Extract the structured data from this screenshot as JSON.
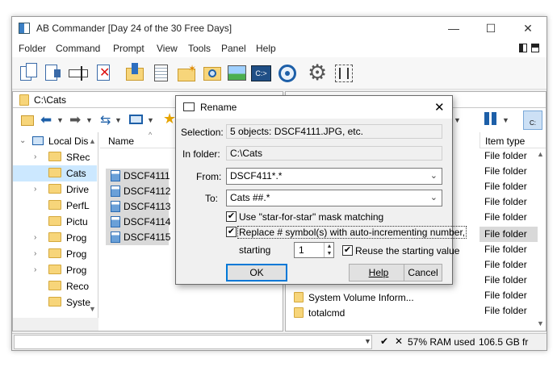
{
  "window": {
    "title": "AB Commander [Day 24 of the 30 Free Days]",
    "minimize": "—",
    "maximize": "☐",
    "close": "✕"
  },
  "menubar": {
    "items": [
      "Folder",
      "Command",
      "Prompt",
      "View",
      "Tools",
      "Panel",
      "Help"
    ]
  },
  "left_pane": {
    "path": "C:\\Cats",
    "tree_root": "Local Dis",
    "tree": [
      {
        "label": "SRec",
        "chev": "›"
      },
      {
        "label": "Cats",
        "chev": ""
      },
      {
        "label": "Drive",
        "chev": "›"
      },
      {
        "label": "PerfL",
        "chev": ""
      },
      {
        "label": "Pictu",
        "chev": ""
      },
      {
        "label": "Prog",
        "chev": "›"
      },
      {
        "label": "Prog",
        "chev": "›"
      },
      {
        "label": "Prog",
        "chev": "›"
      },
      {
        "label": "Reco",
        "chev": ""
      },
      {
        "label": "Syste",
        "chev": ""
      }
    ],
    "name_header": "Name",
    "files": [
      "DSCF4111",
      "DSCF4112",
      "DSCF4113",
      "DSCF4114",
      "DSCF4115"
    ]
  },
  "right_pane": {
    "drive_label": "C:",
    "type_header": "Item type",
    "types": [
      "File folder",
      "File folder",
      "File folder",
      "File folder",
      "File folder",
      "File folder",
      "File folder",
      "File folder",
      "File folder",
      "File folder",
      "File folder"
    ],
    "names": [
      "System Volume Inform...",
      "totalcmd"
    ]
  },
  "statusbar": {
    "ram": "57% RAM used",
    "free": "106.5 GB fr",
    "ok": "✔",
    "cancel": "✕"
  },
  "dialog": {
    "title": "Rename",
    "selection_label": "Selection:",
    "selection_value": "5 objects: DSCF4111.JPG, etc.",
    "folder_label": "In folder:",
    "folder_value": "C:\\Cats",
    "from_label": "From:",
    "from_value": "DSCF411*.*",
    "to_label": "To:",
    "to_value": "Cats ##.*",
    "star_label": "Use \"star-for-star\" mask matching",
    "replace_label": "Replace # symbol(s) with auto-incrementing number,",
    "starting_label": "starting",
    "starting_value": "1",
    "reuse_label": "Reuse the starting value",
    "ok": "OK",
    "help": "Help",
    "cancel": "Cancel",
    "check": "✔"
  },
  "colors": {
    "accent": "#0078d7",
    "folder": "#f7d57a"
  }
}
